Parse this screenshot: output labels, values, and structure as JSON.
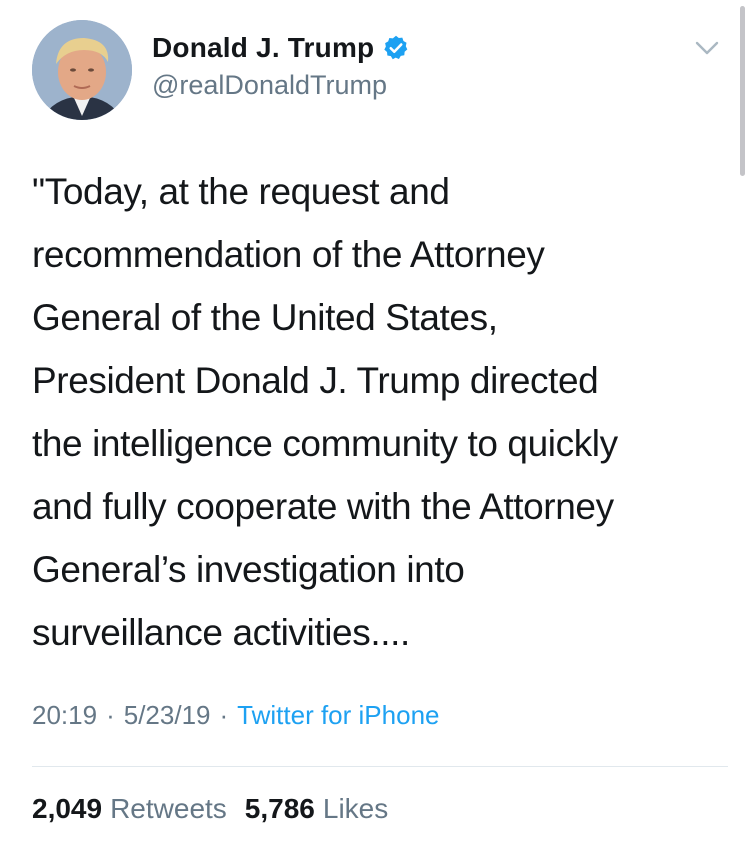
{
  "author": {
    "display_name": "Donald J. Trump",
    "handle": "@realDonaldTrump",
    "verified": true,
    "verified_icon": "verified-badge-icon",
    "menu_icon": "chevron-down-icon"
  },
  "tweet": {
    "text": "\"Today, at the request and\nrecommendation of the Attorney\nGeneral of the United States,\nPresident Donald J. Trump directed\nthe intelligence community to quickly\nand fully cooperate with the Attorney\nGeneral’s investigation into\nsurveillance activities....",
    "time": "20:19",
    "date": "5/23/19",
    "separator": "·",
    "source": "Twitter for iPhone"
  },
  "stats": {
    "retweets_count": "2,049",
    "retweets_label": "Retweets",
    "likes_count": "5,786",
    "likes_label": "Likes"
  },
  "colors": {
    "text": "#14171a",
    "secondary": "#657786",
    "accent": "#1da1f2",
    "divider": "#e1e8ed"
  }
}
